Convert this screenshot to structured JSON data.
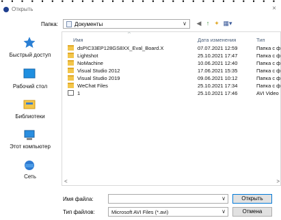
{
  "window": {
    "title": "Открыть",
    "close_label": "×"
  },
  "path_bar": {
    "folder_label": "Папка:",
    "folder_value": "Документы"
  },
  "toolbar": {
    "back_label": "◀",
    "up_label": "↑",
    "new_folder_label": "✦",
    "view_label": "▦▾"
  },
  "sidebar": [
    {
      "label": "Быстрый доступ",
      "icon": "star-icon"
    },
    {
      "label": "Рабочий стол",
      "icon": "desktop-icon"
    },
    {
      "label": "Библиотеки",
      "icon": "libraries-icon"
    },
    {
      "label": "Этот компьютер",
      "icon": "computer-icon"
    },
    {
      "label": "Сеть",
      "icon": "network-icon"
    }
  ],
  "columns": {
    "name": "Имя",
    "modified": "Дата изменения",
    "type": "Тип"
  },
  "files": [
    {
      "name": "dsPIC33EP128GS8XX_Eval_Board.X",
      "modified": "07.07.2021 12:59",
      "type": "Папка с ф",
      "kind": "folder"
    },
    {
      "name": "Lightshot",
      "modified": "25.10.2021 17:47",
      "type": "Папка с ф",
      "kind": "folder"
    },
    {
      "name": "NoMachine",
      "modified": "10.06.2021 12:40",
      "type": "Папка с ф",
      "kind": "folder"
    },
    {
      "name": "Visual Studio 2012",
      "modified": "17.06.2021 15:35",
      "type": "Папка с ф",
      "kind": "folder"
    },
    {
      "name": "Visual Studio 2019",
      "modified": "09.06.2021 10:12",
      "type": "Папка с ф",
      "kind": "folder"
    },
    {
      "name": "WeChat Files",
      "modified": "25.10.2021 17:34",
      "type": "Папка с ф",
      "kind": "folder"
    },
    {
      "name": "1",
      "modified": "25.10.2021 17:46",
      "type": "AVI Video",
      "kind": "video"
    }
  ],
  "bottom": {
    "filename_label": "Имя файла:",
    "filename_value": "",
    "filetype_label": "Тип файлов:",
    "filetype_value": "Microsoft AVI Files (*.avi)",
    "open_label": "Открыть",
    "cancel_label": "Отмена"
  },
  "colors": {
    "accent": "#0078d7",
    "folder": "#f3c64b",
    "header_text": "#4c607a"
  }
}
